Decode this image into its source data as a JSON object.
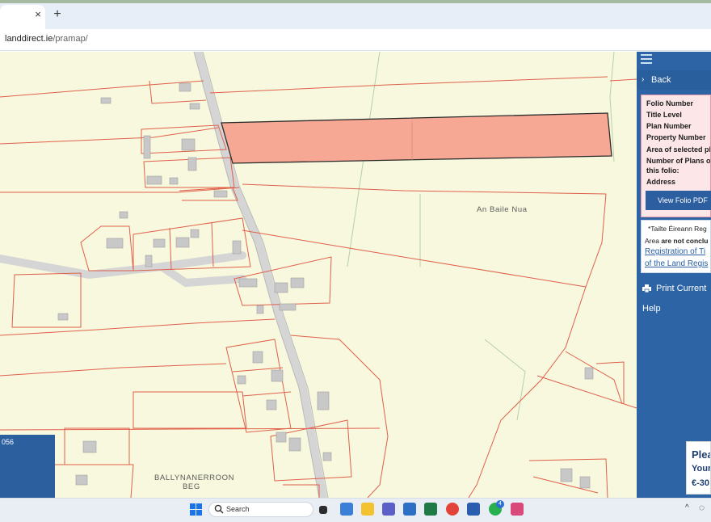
{
  "browser": {
    "tab_close": "×",
    "new_tab": "+",
    "url_host": "landdirect.ie",
    "url_path": "/pramap/"
  },
  "map": {
    "place_labels": [
      "An Baile Nua",
      "BALLYNANERROON",
      "BEG"
    ],
    "info_number": "056",
    "colors": {
      "background": "#f7f8de",
      "boundary": "#e0604a",
      "selected_fill": "#f7a895",
      "road": "#d7d7d7",
      "building": "#c7c7c7"
    }
  },
  "panel": {
    "back_label": "Back",
    "folio_fields": [
      "Folio Number",
      "Title Level",
      "Plan Number",
      "Property Number",
      "Area of selected pla",
      "Number of Plans on",
      "this folio:",
      "Address"
    ],
    "view_pdf_label": "View Folio PDF",
    "notice": {
      "line1": "*Tailte Éireann Reg",
      "line2_prefix": "Area ",
      "line2_bold": "are not conclu",
      "link1": "Registration of Ti",
      "link2": "of the Land Regis"
    },
    "print_label": "Print Current ",
    "help_label": "Help",
    "promo": [
      "Plea",
      "Your",
      "€-30"
    ],
    "colors": {
      "panel": "#2d64a6",
      "folio_bg": "#fde6e8"
    }
  },
  "taskbar": {
    "search_placeholder": "Search",
    "apps": [
      "file-explorer-icon",
      "photos-icon",
      "folder-icon",
      "teams-icon",
      "store-icon",
      "excel-icon",
      "chrome-icon",
      "word-icon",
      "whatsapp-icon",
      "snipping-tool-icon"
    ],
    "chrome_badge": "",
    "whatsapp_badge": "4",
    "tray_chevron": "^"
  }
}
